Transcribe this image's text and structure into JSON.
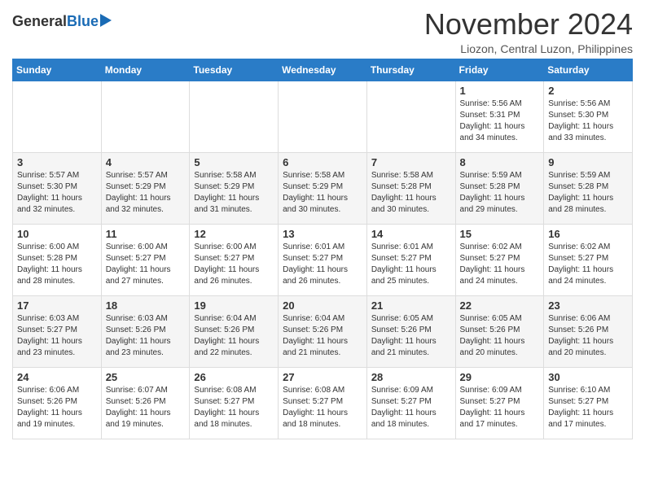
{
  "header": {
    "logo_general": "General",
    "logo_blue": "Blue",
    "month_title": "November 2024",
    "subtitle": "Liozon, Central Luzon, Philippines"
  },
  "weekdays": [
    "Sunday",
    "Monday",
    "Tuesday",
    "Wednesday",
    "Thursday",
    "Friday",
    "Saturday"
  ],
  "weeks": [
    [
      {
        "day": "",
        "info": ""
      },
      {
        "day": "",
        "info": ""
      },
      {
        "day": "",
        "info": ""
      },
      {
        "day": "",
        "info": ""
      },
      {
        "day": "",
        "info": ""
      },
      {
        "day": "1",
        "info": "Sunrise: 5:56 AM\nSunset: 5:31 PM\nDaylight: 11 hours and 34 minutes."
      },
      {
        "day": "2",
        "info": "Sunrise: 5:56 AM\nSunset: 5:30 PM\nDaylight: 11 hours and 33 minutes."
      }
    ],
    [
      {
        "day": "3",
        "info": "Sunrise: 5:57 AM\nSunset: 5:30 PM\nDaylight: 11 hours and 32 minutes."
      },
      {
        "day": "4",
        "info": "Sunrise: 5:57 AM\nSunset: 5:29 PM\nDaylight: 11 hours and 32 minutes."
      },
      {
        "day": "5",
        "info": "Sunrise: 5:58 AM\nSunset: 5:29 PM\nDaylight: 11 hours and 31 minutes."
      },
      {
        "day": "6",
        "info": "Sunrise: 5:58 AM\nSunset: 5:29 PM\nDaylight: 11 hours and 30 minutes."
      },
      {
        "day": "7",
        "info": "Sunrise: 5:58 AM\nSunset: 5:28 PM\nDaylight: 11 hours and 30 minutes."
      },
      {
        "day": "8",
        "info": "Sunrise: 5:59 AM\nSunset: 5:28 PM\nDaylight: 11 hours and 29 minutes."
      },
      {
        "day": "9",
        "info": "Sunrise: 5:59 AM\nSunset: 5:28 PM\nDaylight: 11 hours and 28 minutes."
      }
    ],
    [
      {
        "day": "10",
        "info": "Sunrise: 6:00 AM\nSunset: 5:28 PM\nDaylight: 11 hours and 28 minutes."
      },
      {
        "day": "11",
        "info": "Sunrise: 6:00 AM\nSunset: 5:27 PM\nDaylight: 11 hours and 27 minutes."
      },
      {
        "day": "12",
        "info": "Sunrise: 6:00 AM\nSunset: 5:27 PM\nDaylight: 11 hours and 26 minutes."
      },
      {
        "day": "13",
        "info": "Sunrise: 6:01 AM\nSunset: 5:27 PM\nDaylight: 11 hours and 26 minutes."
      },
      {
        "day": "14",
        "info": "Sunrise: 6:01 AM\nSunset: 5:27 PM\nDaylight: 11 hours and 25 minutes."
      },
      {
        "day": "15",
        "info": "Sunrise: 6:02 AM\nSunset: 5:27 PM\nDaylight: 11 hours and 24 minutes."
      },
      {
        "day": "16",
        "info": "Sunrise: 6:02 AM\nSunset: 5:27 PM\nDaylight: 11 hours and 24 minutes."
      }
    ],
    [
      {
        "day": "17",
        "info": "Sunrise: 6:03 AM\nSunset: 5:27 PM\nDaylight: 11 hours and 23 minutes."
      },
      {
        "day": "18",
        "info": "Sunrise: 6:03 AM\nSunset: 5:26 PM\nDaylight: 11 hours and 23 minutes."
      },
      {
        "day": "19",
        "info": "Sunrise: 6:04 AM\nSunset: 5:26 PM\nDaylight: 11 hours and 22 minutes."
      },
      {
        "day": "20",
        "info": "Sunrise: 6:04 AM\nSunset: 5:26 PM\nDaylight: 11 hours and 21 minutes."
      },
      {
        "day": "21",
        "info": "Sunrise: 6:05 AM\nSunset: 5:26 PM\nDaylight: 11 hours and 21 minutes."
      },
      {
        "day": "22",
        "info": "Sunrise: 6:05 AM\nSunset: 5:26 PM\nDaylight: 11 hours and 20 minutes."
      },
      {
        "day": "23",
        "info": "Sunrise: 6:06 AM\nSunset: 5:26 PM\nDaylight: 11 hours and 20 minutes."
      }
    ],
    [
      {
        "day": "24",
        "info": "Sunrise: 6:06 AM\nSunset: 5:26 PM\nDaylight: 11 hours and 19 minutes."
      },
      {
        "day": "25",
        "info": "Sunrise: 6:07 AM\nSunset: 5:26 PM\nDaylight: 11 hours and 19 minutes."
      },
      {
        "day": "26",
        "info": "Sunrise: 6:08 AM\nSunset: 5:27 PM\nDaylight: 11 hours and 18 minutes."
      },
      {
        "day": "27",
        "info": "Sunrise: 6:08 AM\nSunset: 5:27 PM\nDaylight: 11 hours and 18 minutes."
      },
      {
        "day": "28",
        "info": "Sunrise: 6:09 AM\nSunset: 5:27 PM\nDaylight: 11 hours and 18 minutes."
      },
      {
        "day": "29",
        "info": "Sunrise: 6:09 AM\nSunset: 5:27 PM\nDaylight: 11 hours and 17 minutes."
      },
      {
        "day": "30",
        "info": "Sunrise: 6:10 AM\nSunset: 5:27 PM\nDaylight: 11 hours and 17 minutes."
      }
    ]
  ]
}
